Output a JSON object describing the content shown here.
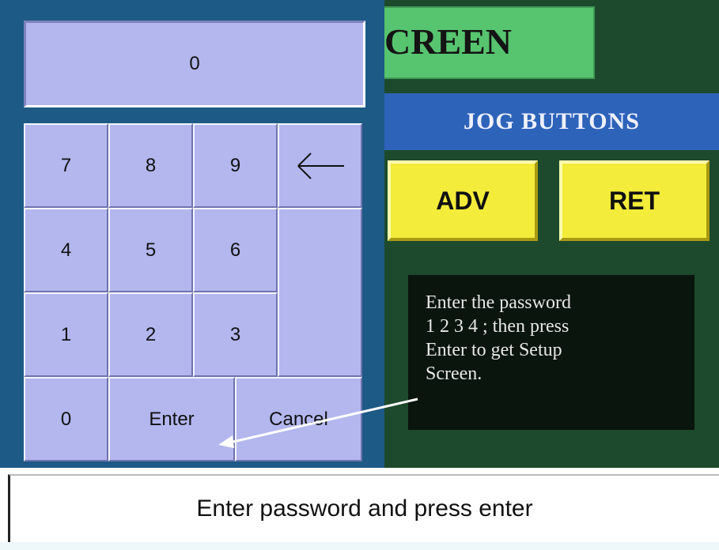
{
  "screen": {
    "title_fragment": "CREEN",
    "jog_header": "JOG  BUTTONS",
    "jog_buttons": {
      "adv": "ADV",
      "ret": "RET"
    },
    "note": "Enter the password\n 1 2 3 4  ; then press\nEnter to get Setup\nScreen."
  },
  "keypad": {
    "display_value": "0",
    "keys": {
      "k7": "7",
      "k8": "8",
      "k9": "9",
      "k4": "4",
      "k5": "5",
      "k6": "6",
      "k1": "1",
      "k2": "2",
      "k3": "3",
      "k0": "0",
      "enter": "Enter",
      "cancel": "Cancel"
    },
    "backspace_icon": "left-arrow-icon"
  },
  "status_bar": {
    "text": "Enter password and press enter"
  },
  "colors": {
    "panel": "#1d5a86",
    "key": "#b3b7ee",
    "screen_bg": "#1d4a2c",
    "title_tab": "#57c46f",
    "jog_header": "#2d63b9",
    "jog_button": "#f3ec3a"
  }
}
